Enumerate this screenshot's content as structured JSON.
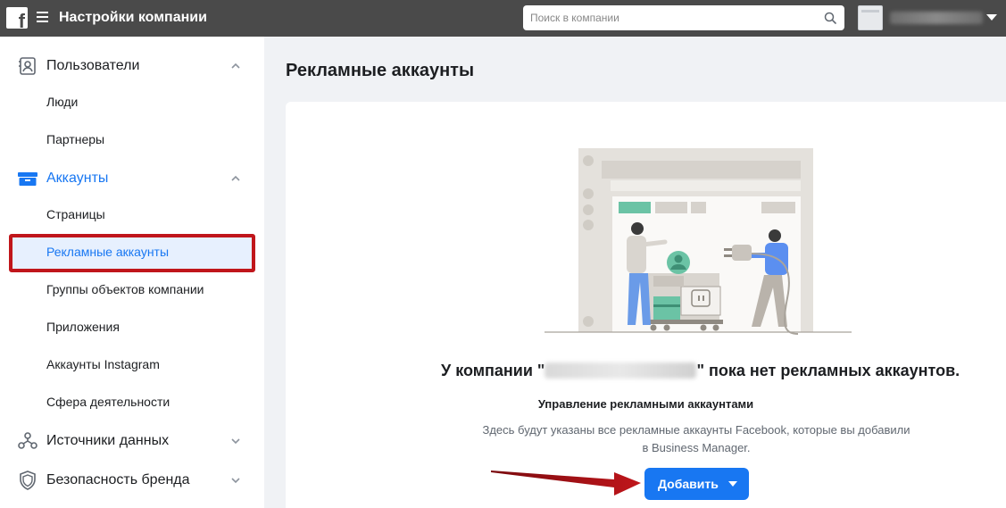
{
  "header": {
    "logo_letter": "f",
    "title": "Настройки компании",
    "search_placeholder": "Поиск в компании"
  },
  "sidebar": {
    "sections": [
      {
        "label": "Пользователи",
        "items": [
          "Люди",
          "Партнеры"
        ]
      },
      {
        "label": "Аккаунты",
        "items": [
          "Страницы",
          "Рекламные аккаунты",
          "Группы объектов компании",
          "Приложения",
          "Аккаунты Instagram",
          "Сфера деятельности"
        ]
      },
      {
        "label": "Источники данных"
      },
      {
        "label": "Безопасность бренда"
      }
    ],
    "selected_item": "Рекламные аккаунты"
  },
  "main": {
    "page_title": "Рекламные аккаунты",
    "empty_prefix": "У компании \"",
    "empty_suffix": "\" пока нет рекламных аккаунтов.",
    "subtitle": "Управление рекламными аккаунтами",
    "description_line1": "Здесь будут указаны все рекламные аккаунты Facebook, которые вы добавили",
    "description_line2": "в Business Manager.",
    "add_button": "Добавить"
  },
  "colors": {
    "topbar": "#4a4a4a",
    "accent": "#1877f2",
    "annotation_red": "#c0161b"
  },
  "icons": [
    "facebook-logo",
    "hamburger-menu-icon",
    "search-icon",
    "chevron-down-icon",
    "users-icon",
    "accounts-icon",
    "data-sources-icon",
    "shield-icon",
    "chevron-up-icon"
  ]
}
